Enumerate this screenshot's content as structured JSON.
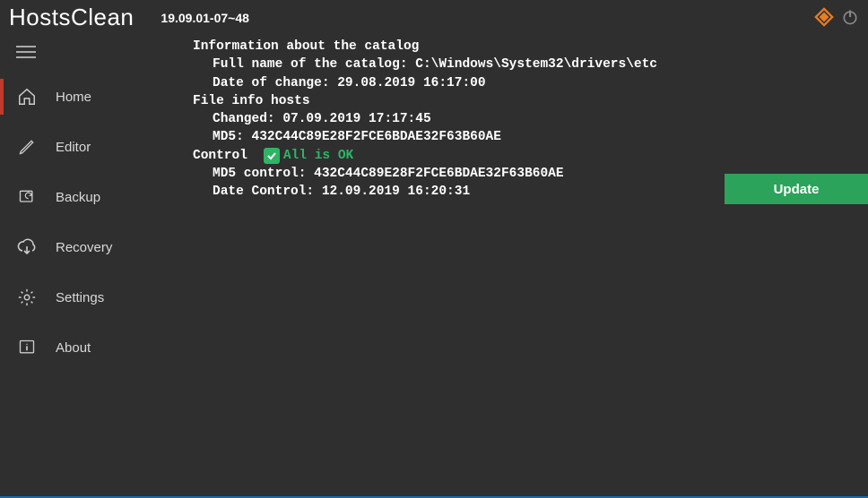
{
  "header": {
    "title": "HostsClean",
    "version": "19.09.01-07~48"
  },
  "sidebar": {
    "items": [
      {
        "label": "Home"
      },
      {
        "label": "Editor"
      },
      {
        "label": "Backup"
      },
      {
        "label": "Recovery"
      },
      {
        "label": "Settings"
      },
      {
        "label": "About"
      }
    ]
  },
  "info": {
    "catalog_heading": "Information about the catalog",
    "full_name_label": "Full name of the catalog:",
    "full_name_value": "C:\\Windows\\System32\\drivers\\etc",
    "date_change_label": "Date of change:",
    "date_change_value": "29.08.2019 16:17:00",
    "file_heading": "File info hosts",
    "changed_label": "Changed:",
    "changed_value": "07.09.2019 17:17:45",
    "md5_label": "MD5:",
    "md5_value": "432C44C89E28F2FCE6BDAE32F63B60AE",
    "control_heading": "Control",
    "status_text": "All is OK",
    "md5_control_label": "MD5 control:",
    "md5_control_value": "432C44C89E28F2FCE6BDAE32F63B60AE",
    "date_control_label": "Date Control:",
    "date_control_value": "12.09.2019 16:20:31"
  },
  "buttons": {
    "update": "Update"
  }
}
